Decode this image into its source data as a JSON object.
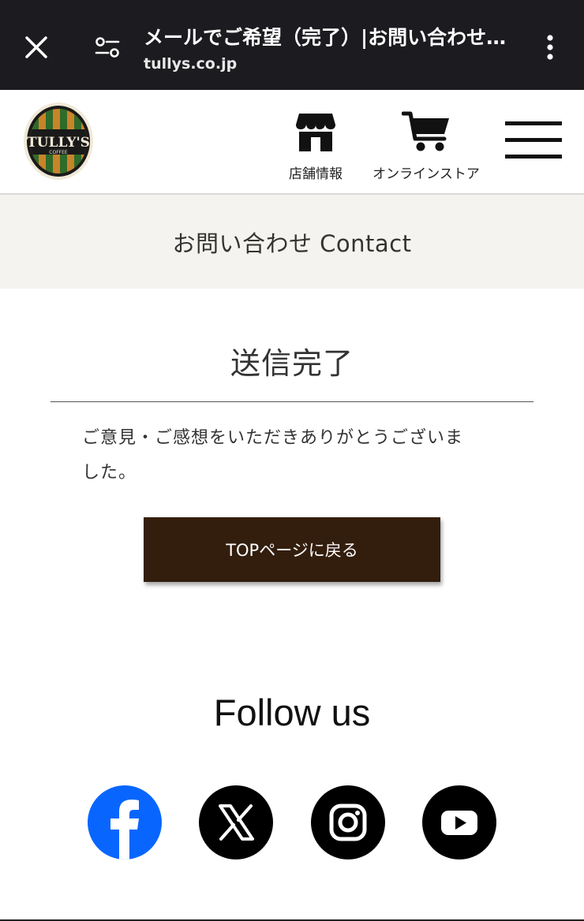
{
  "browser": {
    "title": "メールでご希望（完了）|お問い合わせ…",
    "url": "tullys.co.jp"
  },
  "header": {
    "logo_text": "TULLY'S",
    "logo_sub": "COFFEE",
    "nav": [
      {
        "label": "店舗情報",
        "icon": "store-icon"
      },
      {
        "label": "オンラインストア",
        "icon": "cart-icon"
      }
    ]
  },
  "contact_band": {
    "title": "お問い合わせ Contact"
  },
  "main": {
    "heading": "送信完了",
    "message_line1": "ご意見・ご感想をいただきありがとうございま",
    "message_line2": "した。",
    "top_button": "TOPページに戻る"
  },
  "follow": {
    "heading": "Follow us",
    "icons": [
      "facebook-icon",
      "x-icon",
      "instagram-icon",
      "youtube-icon"
    ]
  },
  "colors": {
    "browser_bar": "#1c1b1f",
    "band": "#f4f3ef",
    "button": "#331e0e",
    "facebook": "#0866ff"
  }
}
